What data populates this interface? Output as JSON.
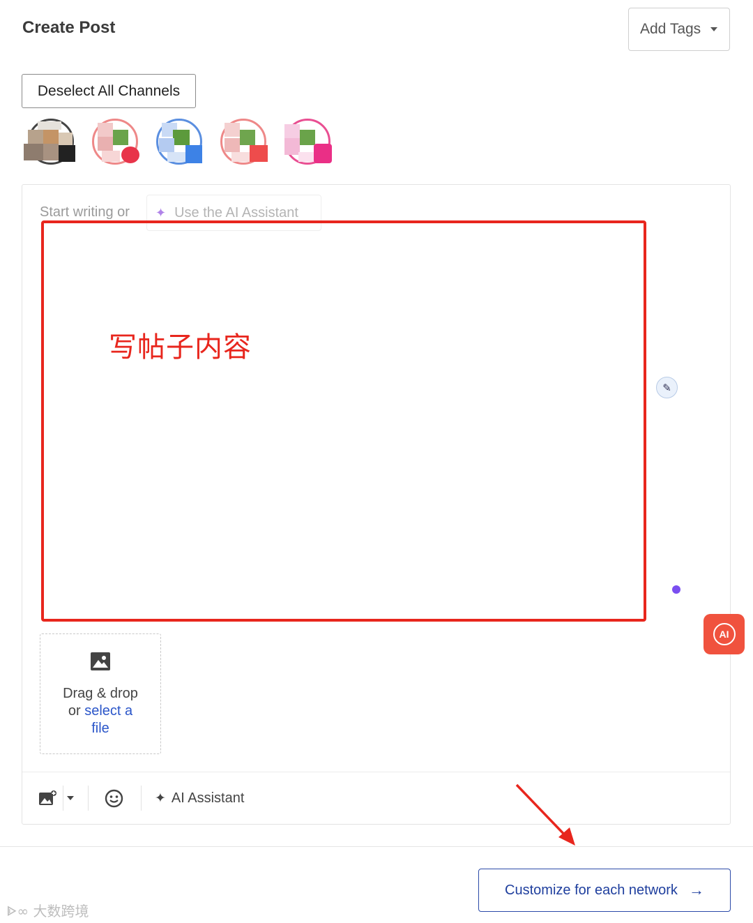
{
  "header": {
    "title": "Create Post",
    "add_tags_label": "Add Tags"
  },
  "channels": {
    "deselect_label": "Deselect All Channels",
    "avatar_count": 5
  },
  "editor": {
    "prompt_text": "Start writing or",
    "ai_chip_label": "Use the AI Assistant",
    "annotation_text": "写帖子内容"
  },
  "dropzone": {
    "line1": "Drag & drop",
    "line2_prefix": "or ",
    "line2_link": "select a",
    "line3_link": "file"
  },
  "toolbar": {
    "ai_label": "AI Assistant"
  },
  "floating": {
    "ai_badge_label": "AI"
  },
  "footer": {
    "customize_label": "Customize for each network",
    "watermark_text": "大数跨境"
  },
  "colors": {
    "accent_blue": "#1f3f9e",
    "annotation_red": "#e8261d",
    "ai_orange": "#f0523e",
    "dot_purple": "#7a4ef0"
  }
}
